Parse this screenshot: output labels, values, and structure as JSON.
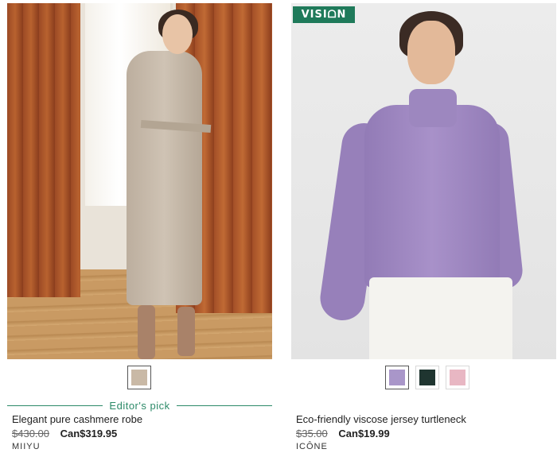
{
  "products": [
    {
      "title": "Elegant pure cashmere robe",
      "price_old": "$430.00",
      "price_new": "Can$319.95",
      "brand": "MIIYU",
      "editors_pick": "Editor's pick",
      "swatches": [
        "#c9b9a6"
      ]
    },
    {
      "badge": "VISIᗝN",
      "title": "Eco-friendly viscose jersey turtleneck",
      "price_old": "$35.00",
      "price_new": "Can$19.99",
      "brand": "ICÔNE",
      "swatches": [
        "#a996c9",
        "#1f3530",
        "#e8b7c3"
      ]
    }
  ]
}
